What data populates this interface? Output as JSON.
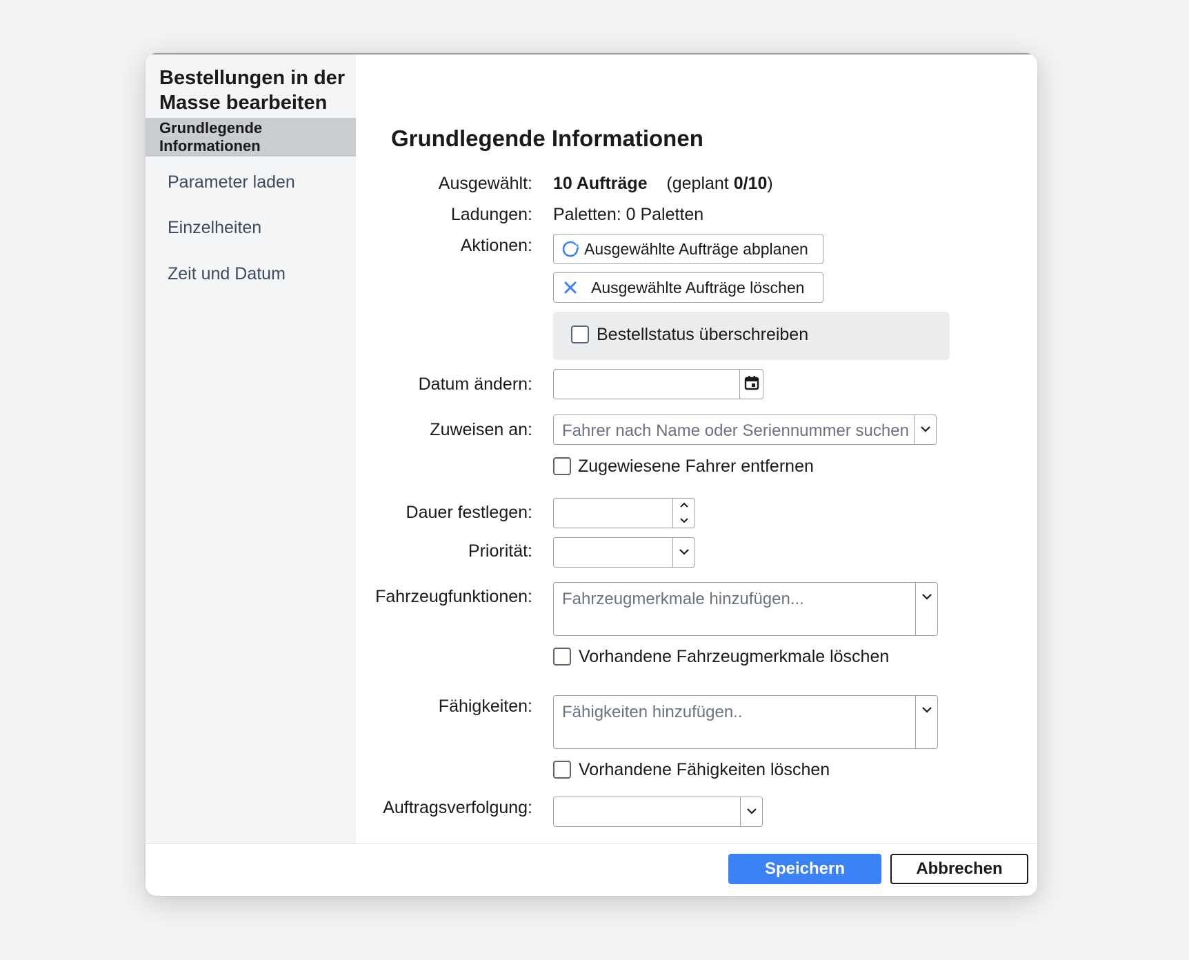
{
  "dialog": {
    "title": "Bestellungen in der Masse bearbeiten"
  },
  "sidebar": {
    "items": [
      {
        "label": "Grundlegende Informationen",
        "active": true
      },
      {
        "label": "Parameter laden",
        "active": false
      },
      {
        "label": "Einzelheiten",
        "active": false
      },
      {
        "label": "Zeit und Datum",
        "active": false
      }
    ]
  },
  "main": {
    "section_title": "Grundlegende Informationen",
    "selected": {
      "label": "Ausgewählt:",
      "count": "10 Aufträge",
      "planned_prefix": "(geplant",
      "planned_value": "0/10",
      "planned_suffix": ")"
    },
    "loads": {
      "label": "Ladungen:",
      "value": "Paletten: 0 Paletten"
    },
    "actions": {
      "label": "Aktionen:",
      "unplan_label": "Ausgewählte Aufträge abplanen",
      "delete_label": "Ausgewählte Aufträge löschen",
      "override_status_label": "Bestellstatus überschreiben"
    },
    "date": {
      "label": "Datum ändern:",
      "value": ""
    },
    "assign": {
      "label": "Zuweisen an:",
      "placeholder": "Fahrer nach Name oder Seriennummer suchen",
      "remove_label": "Zugewiesene Fahrer entfernen"
    },
    "duration": {
      "label": "Dauer festlegen:",
      "value": ""
    },
    "priority": {
      "label": "Priorität:",
      "value": ""
    },
    "vehicle_features": {
      "label": "Fahrzeugfunktionen:",
      "placeholder": "Fahrzeugmerkmale hinzufügen...",
      "clear_label": "Vorhandene Fahrzeugmerkmale löschen"
    },
    "skills": {
      "label": "Fähigkeiten:",
      "placeholder": "Fähigkeiten hinzufügen..",
      "clear_label": "Vorhandene Fähigkeiten löschen"
    },
    "tracking": {
      "label": "Auftragsverfolgung:",
      "value": ""
    }
  },
  "footer": {
    "save_label": "Speichern",
    "cancel_label": "Abbrechen"
  },
  "colors": {
    "accent": "#3b82f6",
    "sidebar_bg": "#f4f5f7",
    "sidebar_active": "#c9ccd1"
  }
}
